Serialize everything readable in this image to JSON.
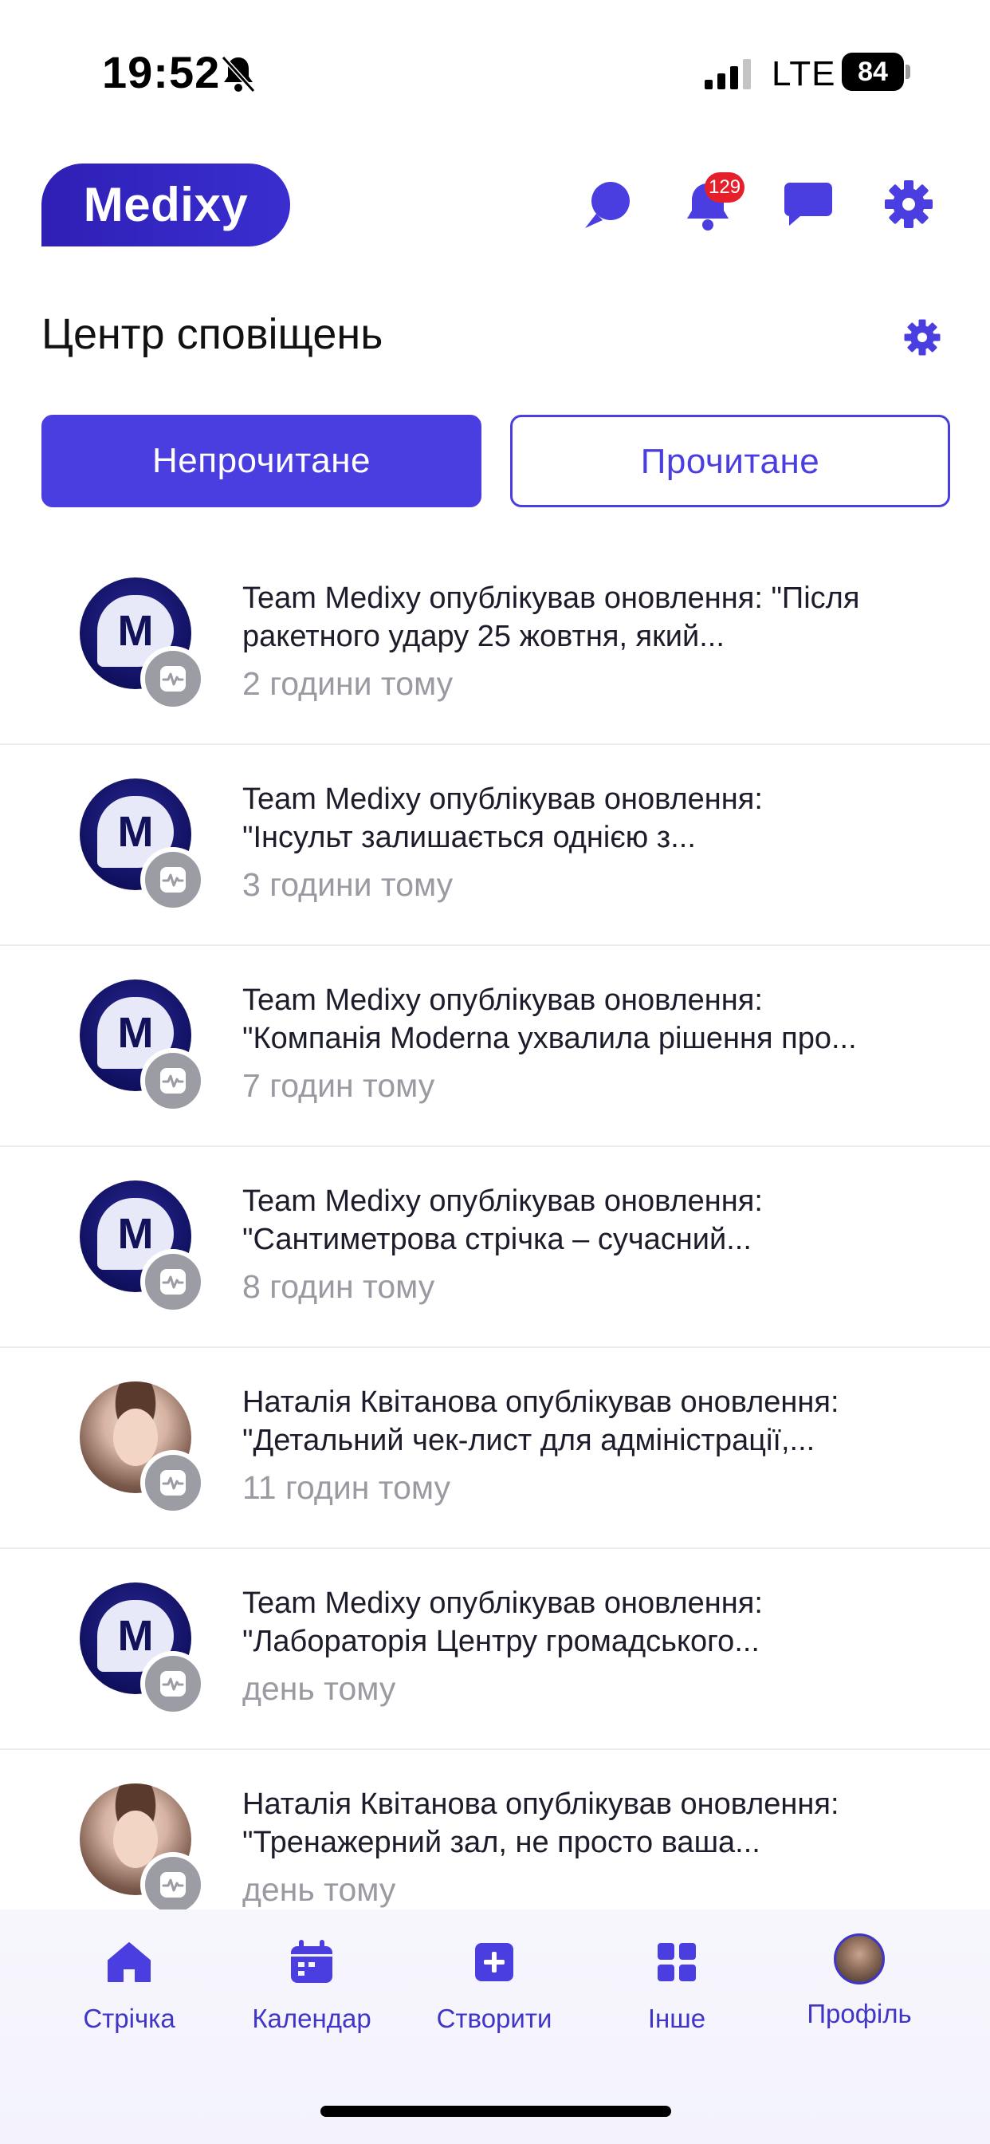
{
  "status_bar": {
    "time": "19:52",
    "network": "LTE",
    "battery": "84"
  },
  "header": {
    "logo": "Medixy",
    "notification_count": "129"
  },
  "title": "Центр сповіщень",
  "tabs": {
    "unread": "Непрочитане",
    "read": "Прочитане"
  },
  "notifications": [
    {
      "line1": "Team Medixy опублікував оновлення: \"Після",
      "line2": "ракетного удару 25 жовтня, який...",
      "time": "2 години тому",
      "avatar": "medixy"
    },
    {
      "line1": "Team Medixy опублікував оновлення:",
      "line2": "\"Інсульт залишається однією з...",
      "time": "3 години тому",
      "avatar": "medixy"
    },
    {
      "line1": "Team Medixy опублікував оновлення:",
      "line2": "\"Компанія Moderna ухвалила рішення про...",
      "time": "7 годин тому",
      "avatar": "medixy"
    },
    {
      "line1": "Team Medixy опублікував оновлення:",
      "line2": "\"Сантиметрова стрічка – сучасний...",
      "time": "8 годин тому",
      "avatar": "medixy"
    },
    {
      "line1": "Наталія Квітанова опублікував оновлення:",
      "line2": "\"Детальний чек-лист для адміністрації,...",
      "time": "11 годин тому",
      "avatar": "photo"
    },
    {
      "line1": "Team Medixy опублікував оновлення:",
      "line2": "\"Лабораторія Центру громадського...",
      "time": "день тому",
      "avatar": "medixy"
    },
    {
      "line1": "Наталія Квітанова опублікував оновлення:",
      "line2": "\"Тренажерний зал, не просто ваша...",
      "time": "день тому",
      "avatar": "photo"
    }
  ],
  "avatar_letter": "M",
  "bottom_nav": {
    "feed": "Стрічка",
    "calendar": "Календар",
    "create": "Створити",
    "other": "Інше",
    "profile": "Профіль"
  },
  "colors": {
    "accent": "#4a3ee0",
    "logo": "#2e1fb5",
    "badge": "#e5202b",
    "muted_text": "#9a9aa2"
  }
}
